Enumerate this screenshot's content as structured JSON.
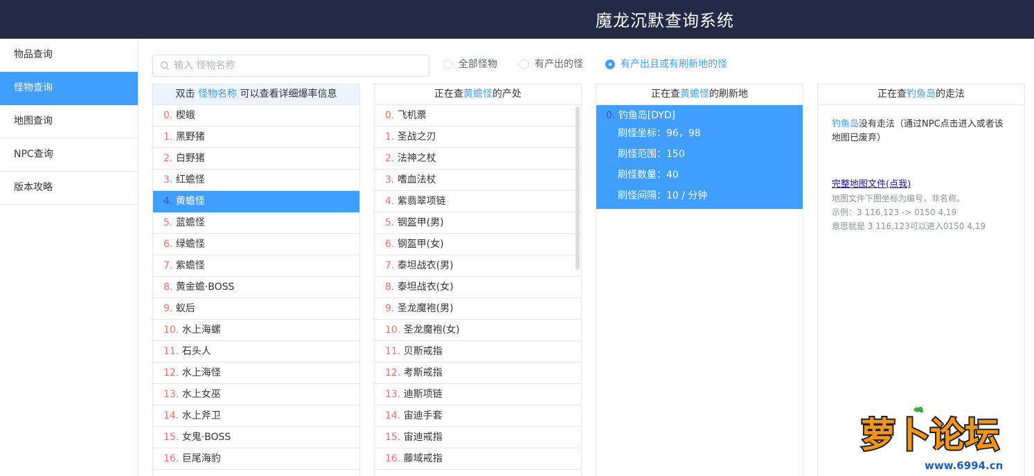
{
  "header": {
    "title": "魔龙沉默查询系统"
  },
  "sidebar": {
    "items": [
      {
        "label": "物品查询",
        "active": false
      },
      {
        "label": "怪物查询",
        "active": true
      },
      {
        "label": "地图查询",
        "active": false
      },
      {
        "label": "NPC查询",
        "active": false
      },
      {
        "label": "版本攻略",
        "active": false
      }
    ]
  },
  "search": {
    "placeholder": "输入 怪物名称",
    "value": ""
  },
  "filters": {
    "options": [
      "全部怪物",
      "有产出的怪",
      "有产出且或有刷新地的怪"
    ],
    "selected": "有产出且或有刷新地的怪"
  },
  "monster_panel": {
    "head_prefix": "双击",
    "head_hl": "怪物名称",
    "head_suffix": "可以查看详细爆率信息",
    "rows": [
      {
        "num": "0.",
        "name": "楔蛾"
      },
      {
        "num": "1.",
        "name": "黑野猪"
      },
      {
        "num": "2.",
        "name": "白野猪"
      },
      {
        "num": "3.",
        "name": "红蟾怪"
      },
      {
        "num": "4.",
        "name": "黄蟾怪"
      },
      {
        "num": "5.",
        "name": "蓝蟾怪"
      },
      {
        "num": "6.",
        "name": "绿蟾怪"
      },
      {
        "num": "7.",
        "name": "紫蟾怪"
      },
      {
        "num": "8.",
        "name": "黄金蟾·BOSS"
      },
      {
        "num": "9.",
        "name": "蚁后"
      },
      {
        "num": "10.",
        "name": "水上海螺"
      },
      {
        "num": "11.",
        "name": "石头人"
      },
      {
        "num": "12.",
        "name": "水上海怪"
      },
      {
        "num": "13.",
        "name": "水上女巫"
      },
      {
        "num": "14.",
        "name": "水上斧卫"
      },
      {
        "num": "15.",
        "name": "女鬼·BOSS"
      },
      {
        "num": "16.",
        "name": "巨尾海豹"
      }
    ],
    "selected_index": 4
  },
  "drops_panel": {
    "head_prefix": "正在查",
    "head_hl": "黄蟾怪",
    "head_suffix": "的产处",
    "rows": [
      {
        "num": "0.",
        "name": "飞机票"
      },
      {
        "num": "1.",
        "name": "圣战之刃"
      },
      {
        "num": "2.",
        "name": "法神之杖"
      },
      {
        "num": "3.",
        "name": "嗜血法杖"
      },
      {
        "num": "4.",
        "name": "紫翡翠项链"
      },
      {
        "num": "5.",
        "name": "钢盔甲(男)"
      },
      {
        "num": "6.",
        "name": "钢盔甲(女)"
      },
      {
        "num": "7.",
        "name": "泰坦战衣(男)"
      },
      {
        "num": "8.",
        "name": "泰坦战衣(女)"
      },
      {
        "num": "9.",
        "name": "圣龙魔袍(男)"
      },
      {
        "num": "10.",
        "name": "圣龙魔袍(女)"
      },
      {
        "num": "11.",
        "name": "贝斯戒指"
      },
      {
        "num": "12.",
        "name": "考斯戒指"
      },
      {
        "num": "13.",
        "name": "迪斯项链"
      },
      {
        "num": "14.",
        "name": "宙迪手套"
      },
      {
        "num": "15.",
        "name": "宙迪戒指"
      },
      {
        "num": "16.",
        "name": "藤域戒指"
      }
    ]
  },
  "spawn_panel": {
    "head_prefix": "正在查",
    "head_hl": "黄蟾怪",
    "head_suffix": "的刷新地",
    "entry": {
      "num": "0.",
      "map": "钓鱼岛[DYD]",
      "coord": "刷怪坐标：96，98",
      "range": "刷怪范围：150",
      "count": "刷怪数量：40",
      "interval": "刷怪间隔：10 / 分钟"
    }
  },
  "route_panel": {
    "head_prefix": "正在查",
    "head_hl": "钓鱼岛",
    "head_suffix": "的走法",
    "map_name": "钓鱼岛",
    "text": "没有走法（通过NPC点击进入或者该地图已废弃）",
    "link": "完整地图文件(点我)",
    "notes": [
      "地图文件下图坐标为编号，非名称。",
      "示例：3 116,123 -> 0150 4,19",
      "意思就是 3 116,123可以进入0150 4,19"
    ]
  },
  "watermark": {
    "text": "萝卜论坛",
    "url": "www.6994.cn"
  },
  "colors": {
    "header_bg": "#222a45",
    "accent": "#409eff",
    "index_red": "#f56c6c"
  }
}
